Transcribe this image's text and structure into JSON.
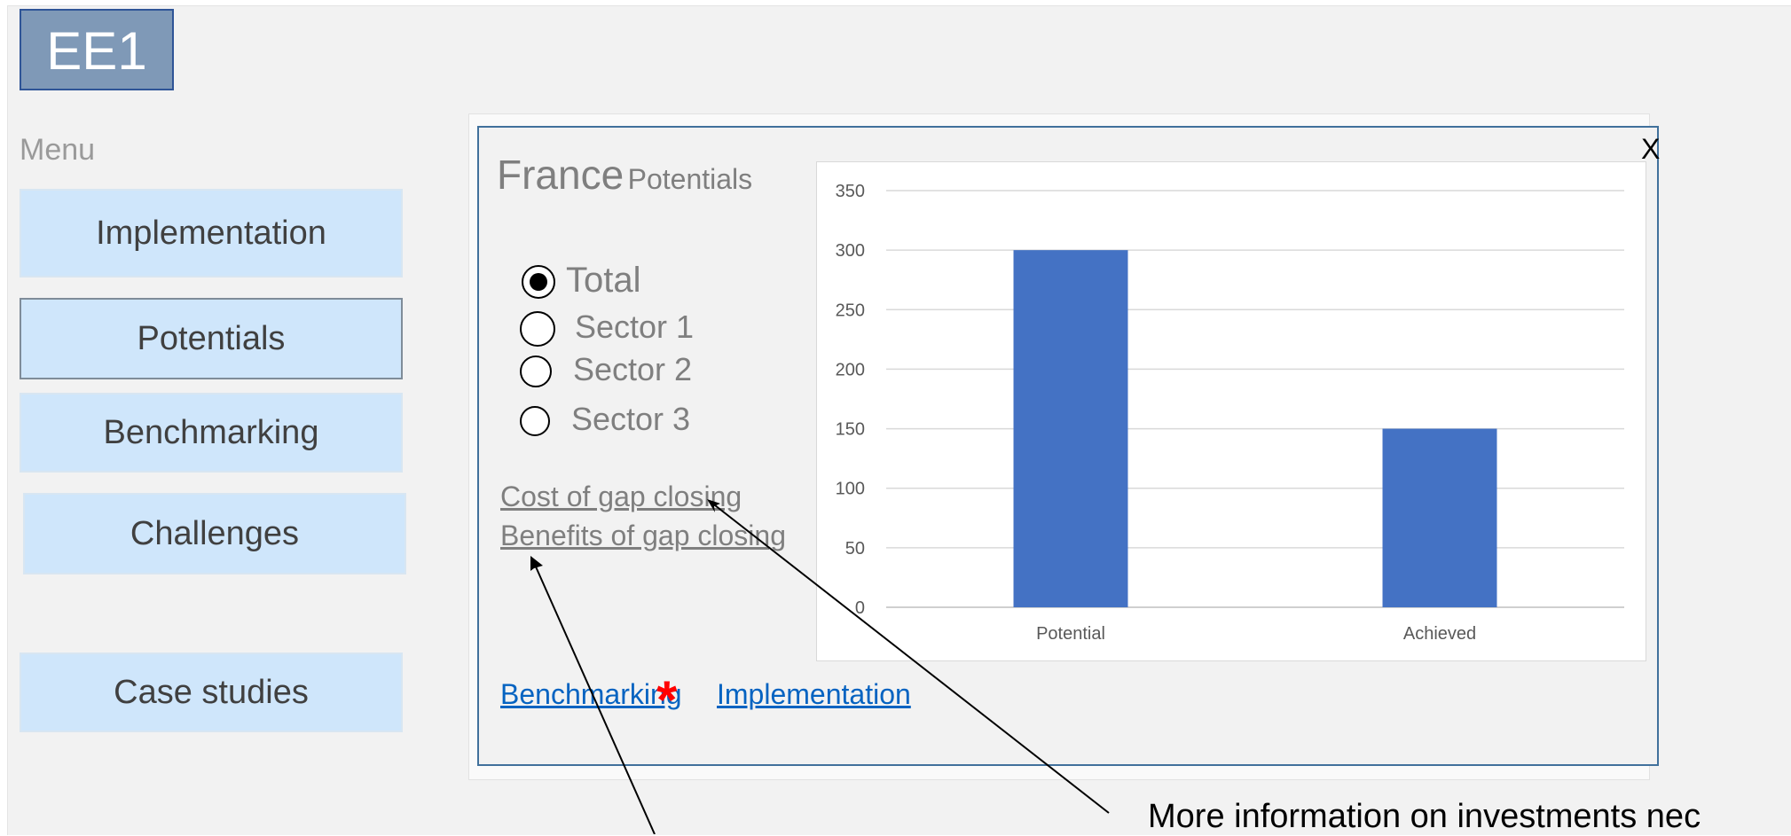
{
  "logo": {
    "text": "EE1"
  },
  "menu": {
    "label": "Menu",
    "items": [
      {
        "label": "Implementation",
        "active": false
      },
      {
        "label": "Potentials",
        "active": true
      },
      {
        "label": "Benchmarking",
        "active": false
      },
      {
        "label": "Challenges",
        "active": false
      },
      {
        "label": "Case studies",
        "active": false
      }
    ]
  },
  "dialog": {
    "close_label": "X",
    "country": "France",
    "subtitle": "Potentials",
    "options": [
      {
        "label": "Total",
        "selected": true
      },
      {
        "label": "Sector 1",
        "selected": false
      },
      {
        "label": "Sector 2",
        "selected": false
      },
      {
        "label": "Sector 3",
        "selected": false
      }
    ],
    "links": {
      "cost": "Cost of gap closing",
      "benefits": "Benefits of gap closing",
      "benchmarking": "Benchmarking",
      "implementation": "Implementation"
    },
    "asterisk": "*",
    "asterisk_color": "#ff0000"
  },
  "annotation": {
    "text": "More information on investments nec"
  },
  "chart_data": {
    "type": "bar",
    "categories": [
      "Potential",
      "Achieved"
    ],
    "values": [
      300,
      150
    ],
    "ylim": [
      0,
      350
    ],
    "yticks": [
      0,
      50,
      100,
      150,
      200,
      250,
      300,
      350
    ],
    "bar_color": "#4472c4",
    "grid": true,
    "title": "",
    "xlabel": "",
    "ylabel": ""
  }
}
